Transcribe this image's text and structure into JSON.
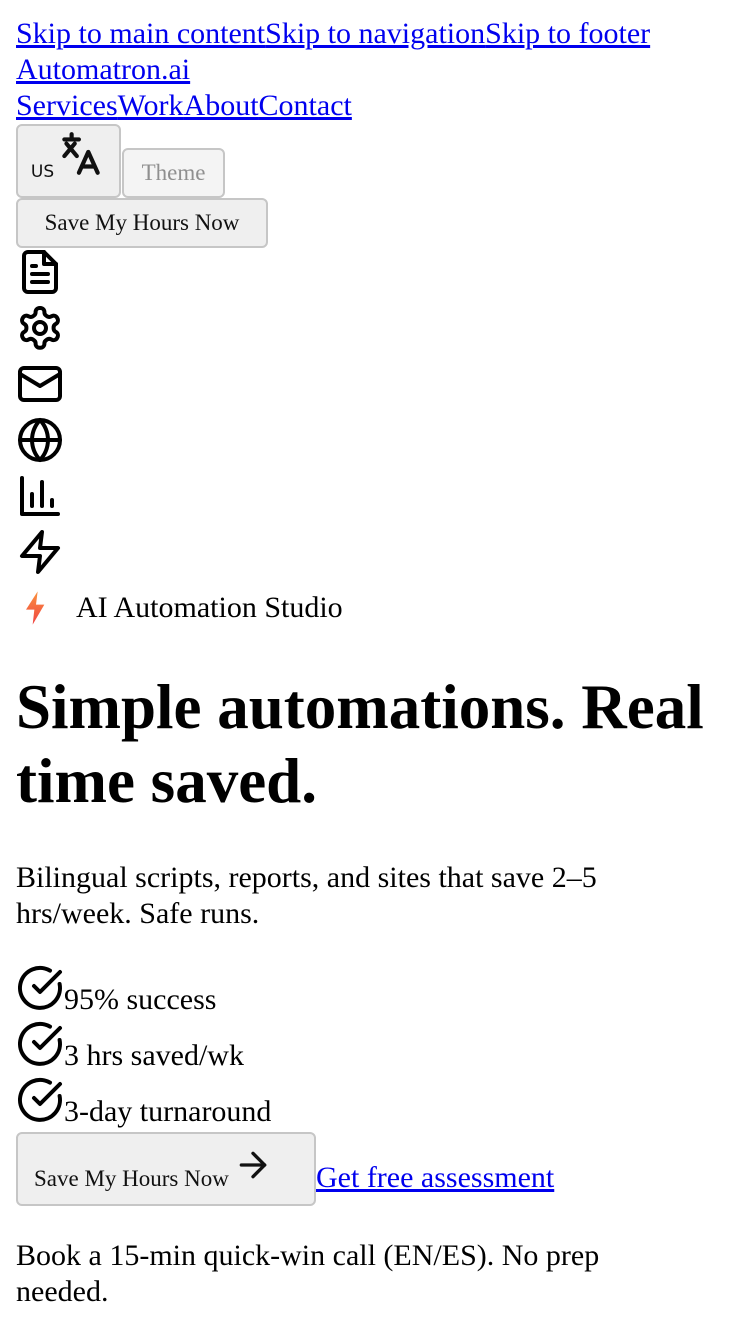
{
  "skip_links": {
    "main": "Skip to main content",
    "navigation": "Skip to navigation",
    "footer": "Skip to footer"
  },
  "logo": "Automatron.ai",
  "nav": {
    "items": [
      "Services",
      "Work",
      "About",
      "Contact"
    ]
  },
  "language_button": {
    "code": "US",
    "icon": "translate-icon"
  },
  "theme_button": "Theme",
  "header_cta": "Save My Hours Now",
  "feature_icons": [
    "document-icon",
    "gear-icon",
    "mail-icon",
    "globe-icon",
    "bar-chart-icon",
    "lightning-icon"
  ],
  "hero": {
    "tag": "AI Automation Studio",
    "tag_icon_color": "#f97316",
    "title": "Simple automations. Real time saved.",
    "subtitle": "Bilingual scripts, reports, and sites that save 2–5 hrs/week. Safe runs.",
    "stats": [
      "95% success",
      "3 hrs saved/wk",
      "3-day turnaround"
    ],
    "primary_cta": "Save My Hours Now",
    "secondary_cta": "Get free assessment",
    "note": "Book a 15-min quick-win call (EN/ES). No prep needed."
  }
}
